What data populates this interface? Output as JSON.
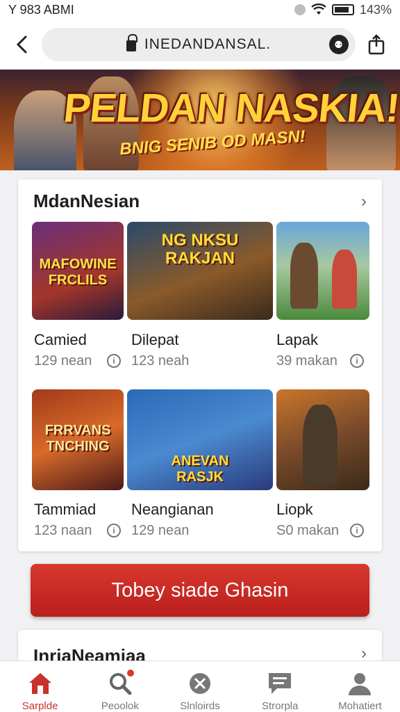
{
  "status_bar": {
    "time": "Y 983 ABMI",
    "battery": "143%"
  },
  "browser": {
    "url": "INEDANDANSAL."
  },
  "banner": {
    "title": "PELDAN NASKIA!",
    "subtitle": "BNIG SENIB OD MASN!"
  },
  "section1": {
    "title": "MdanNesian",
    "games": [
      {
        "name": "Camied",
        "meta": "129 nean",
        "art_text": "MAFOWINE FRCLILS"
      },
      {
        "name": "Dilepat",
        "meta": "123 neah",
        "art_text": "NG NKSU RAKJAN"
      },
      {
        "name": "Lapak",
        "meta": "39 makan",
        "art_text": ""
      },
      {
        "name": "Tammiad",
        "meta": "123 naan",
        "art_text": "FRRVANS TNCHING"
      },
      {
        "name": "Neangianan",
        "meta": "129 nean",
        "art_text": "ANEVAN RASJK"
      },
      {
        "name": "Liopk",
        "meta": "S0 makan",
        "art_text": ""
      }
    ]
  },
  "cta": {
    "label": "Tobey siade Ghasin"
  },
  "section2": {
    "title": "InriaNeamiaa"
  },
  "bottom_nav": [
    {
      "label": "Sarplde",
      "icon": "home-icon",
      "active": true
    },
    {
      "label": "Peoolok",
      "icon": "search-icon",
      "active": false
    },
    {
      "label": "Slnloirds",
      "icon": "games-icon",
      "active": false
    },
    {
      "label": "Strorpla",
      "icon": "chat-icon",
      "active": false
    },
    {
      "label": "Mohatiert",
      "icon": "profile-icon",
      "active": false
    }
  ],
  "colors": {
    "accent": "#c8322a",
    "button": "#d0302a"
  }
}
